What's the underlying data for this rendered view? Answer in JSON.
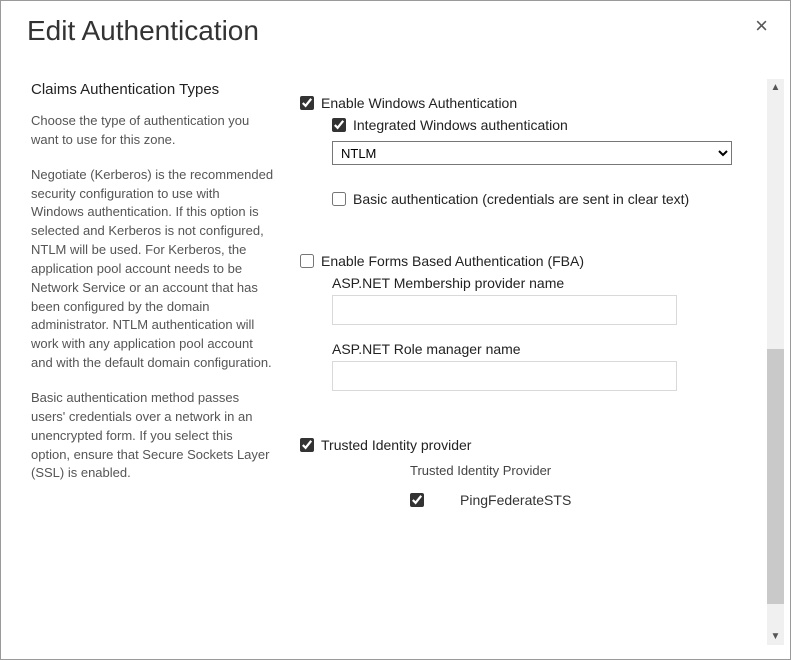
{
  "dialog": {
    "title": "Edit Authentication",
    "close_glyph": "×"
  },
  "left": {
    "heading": "Claims Authentication Types",
    "p1": "Choose the type of authentication you want to use for this zone.",
    "p2": "Negotiate (Kerberos) is the recommended security configuration to use with Windows authentication. If this option is selected and Kerberos is not configured, NTLM will be used. For Kerberos, the application pool account needs to be Network Service or an account that has been configured by the domain administrator. NTLM authentication will work with any application pool account and with the default domain configuration.",
    "p3": "Basic authentication method passes users' credentials over a network in an unencrypted form. If you select this option, ensure that Secure Sockets Layer (SSL) is enabled."
  },
  "right": {
    "enable_windows": {
      "label": "Enable Windows Authentication",
      "checked": true
    },
    "integrated": {
      "label": "Integrated Windows authentication",
      "checked": true
    },
    "auth_select": {
      "value": "NTLM",
      "options": [
        "NTLM"
      ]
    },
    "basic": {
      "label": "Basic authentication (credentials are sent in clear text)",
      "checked": false
    },
    "enable_fba": {
      "label": "Enable Forms Based Authentication (FBA)",
      "checked": false
    },
    "membership_label": "ASP.NET Membership provider name",
    "membership_value": "",
    "role_label": "ASP.NET Role manager name",
    "role_value": "",
    "trusted": {
      "label": "Trusted Identity provider",
      "checked": true
    },
    "trusted_sub": "Trusted Identity Provider",
    "pingfed": {
      "label": "PingFederateSTS",
      "checked": true
    }
  },
  "scroll": {
    "up": "▲",
    "down": "▼"
  }
}
